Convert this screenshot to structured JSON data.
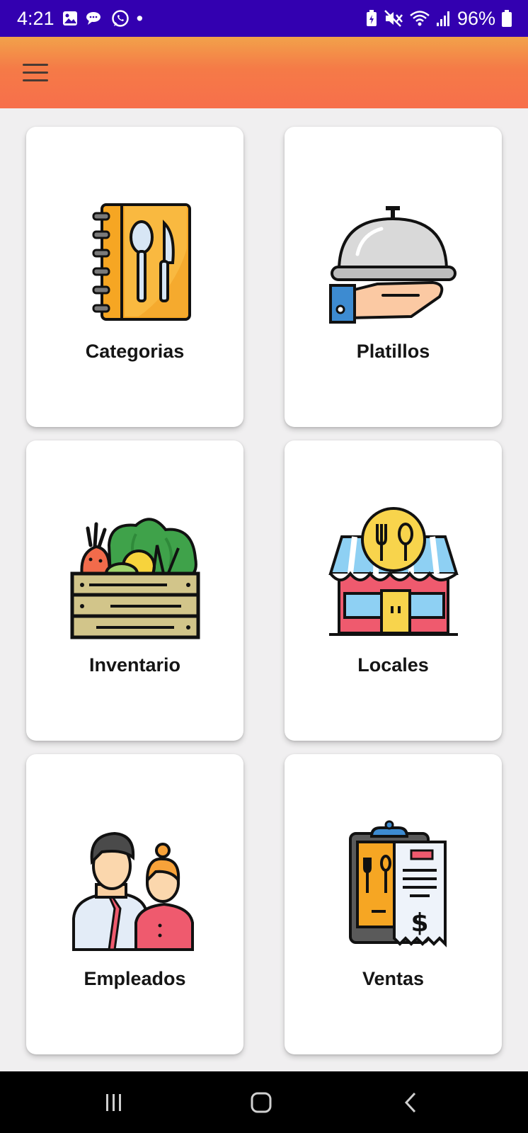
{
  "status_bar": {
    "time": "4:21",
    "battery": "96%",
    "dot": "•",
    "icons_left": [
      "gallery-icon",
      "chat-bubbles-icon",
      "whatsapp-icon",
      "dot-icon"
    ],
    "icons_right": [
      "battery-saver-icon",
      "mute-icon",
      "wifi-calling-icon",
      "signal-icon",
      "battery-icon"
    ]
  },
  "app_bar": {
    "menu_icon": "hamburger-menu-icon",
    "gradient": [
      "#f2a24a",
      "#f76f4b"
    ]
  },
  "menu": [
    {
      "label": "Categorias",
      "icon": "menu-book-cutlery-icon"
    },
    {
      "label": "Platillos",
      "icon": "serving-cloche-hand-icon"
    },
    {
      "label": "Inventario",
      "icon": "vegetable-crate-icon"
    },
    {
      "label": "Locales",
      "icon": "restaurant-storefront-icon"
    },
    {
      "label": "Empleados",
      "icon": "employees-icon"
    },
    {
      "label": "Ventas",
      "icon": "sales-receipt-icon"
    }
  ],
  "nav_bar": {
    "buttons": [
      "recents-icon",
      "home-icon",
      "back-icon"
    ]
  },
  "colors": {
    "status_bar": "#3300b0",
    "background": "#f0eff0",
    "card": "#ffffff",
    "nav_bar": "#000000"
  }
}
